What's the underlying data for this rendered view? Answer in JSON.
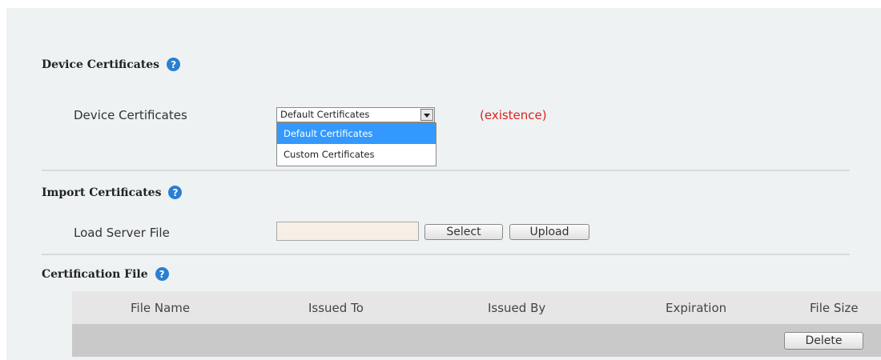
{
  "device_certificates": {
    "section_title": "Device Certificates",
    "field_label": "Device Certificates",
    "select_value": "Default Certificates",
    "options": [
      "Default Certificates",
      "Custom Certificates"
    ],
    "status": "(existence)"
  },
  "import_certificates": {
    "section_title": "Import Certificates",
    "field_label": "Load Server File",
    "file_value": "",
    "select_button": "Select",
    "upload_button": "Upload"
  },
  "certification_file": {
    "section_title": "Certification File",
    "columns": [
      "File Name",
      "Issued To",
      "Issued By",
      "Expiration",
      "File Size"
    ],
    "delete_button": "Delete"
  },
  "help_glyph": "?",
  "colors": {
    "panel_bg": "#eef2f3",
    "help_icon": "#2a7fd0",
    "status_red": "#e02020",
    "option_highlight": "#3399ff",
    "table_header_bg": "#e6e6e6",
    "table_row_bg": "#c9c9c9"
  }
}
